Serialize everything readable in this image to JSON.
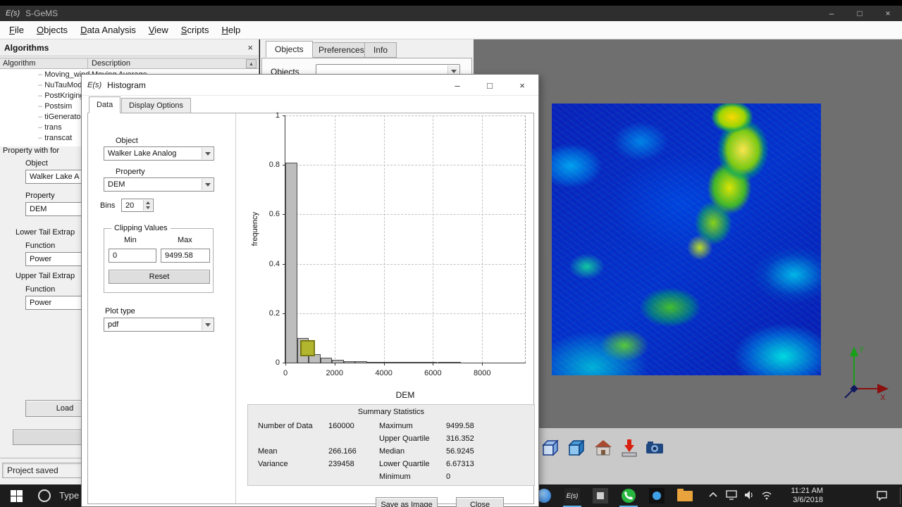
{
  "titlebar": {
    "logo": "E(s)",
    "title": "S-GeMS"
  },
  "icons": {
    "minimize": "–",
    "maximize": "□",
    "close": "×",
    "panel_close": "×",
    "scroll_up": "▴"
  },
  "menubar": {
    "items": [
      "File",
      "Objects",
      "Data Analysis",
      "View",
      "Scripts",
      "Help"
    ]
  },
  "algorithms": {
    "title": "Algorithms",
    "col1": "Algorithm",
    "col2": "Description",
    "rows": [
      {
        "name": "Moving_wind",
        "desc": "Moving Average"
      },
      {
        "name": "NuTauModel",
        "desc": ""
      },
      {
        "name": "PostKriging",
        "desc": ""
      },
      {
        "name": "Postsim",
        "desc": ""
      },
      {
        "name": "tiGenerator",
        "desc": ""
      },
      {
        "name": "trans",
        "desc": ""
      },
      {
        "name": "transcat",
        "desc": ""
      }
    ]
  },
  "params": {
    "header": "Property with for",
    "object_label": "Object",
    "object_value": "Walker Lake A",
    "property_label": "Property",
    "property_value": "DEM",
    "lower_group": "Lower Tail Extrap",
    "function_label": "Function",
    "lower_function": "Power",
    "upper_group": "Upper Tail Extrap",
    "upper_function": "Power",
    "load": "Load"
  },
  "statusbar": {
    "text": "Project saved"
  },
  "side_tabs": {
    "tabs": [
      "Objects",
      "Preferences",
      "Info"
    ],
    "objects_label": "Objects"
  },
  "dialog": {
    "logo": "E(s)",
    "title": "Histogram",
    "tabs": [
      "Data",
      "Display Options"
    ],
    "object_label": "Object",
    "object_value": "Walker Lake Analog",
    "property_label": "Property",
    "property_value": "DEM",
    "bins_label": "Bins",
    "bins_value": "20",
    "clipping_title": "Clipping Values",
    "min_label": "Min",
    "max_label": "Max",
    "min_value": "0",
    "max_value": "9499.58",
    "reset": "Reset",
    "plot_type_label": "Plot type",
    "plot_type_value": "pdf",
    "stats_title": "Summary Statistics",
    "stats_rows": [
      [
        "Number of Data",
        "160000",
        "Maximum",
        "9499.58"
      ],
      [
        "",
        "",
        "Upper Quartile",
        "316.352"
      ],
      [
        "Mean",
        "266.166",
        "Median",
        "56.9245"
      ],
      [
        "Variance",
        "239458",
        "Lower Quartile",
        "6.67313"
      ],
      [
        "",
        "",
        "Minimum",
        "0"
      ]
    ],
    "save_button": "Save as Image",
    "close_button": "Close"
  },
  "chart_data": {
    "type": "bar",
    "xlabel": "DEM",
    "ylabel": "frequency",
    "xlim": [
      0,
      9770
    ],
    "ylim": [
      0,
      1
    ],
    "x_ticks": [
      0,
      2000,
      4000,
      6000,
      8000
    ],
    "y_ticks": [
      0,
      0.2,
      0.4,
      0.6,
      0.8,
      1
    ],
    "bins": 20,
    "bin_start": 0,
    "bin_width": 474.98,
    "values": [
      0.81,
      0.1,
      0.033,
      0.02,
      0.012,
      0.007,
      0.0045,
      0.0028,
      0.0018,
      0.0012,
      0.0008,
      0.0005,
      0.0003,
      0.0002,
      0.0001,
      0,
      0,
      0,
      0,
      0
    ],
    "grid": true,
    "legend": "none",
    "bar_color": "#bdbdbd",
    "bar_border": "#4a4a4a",
    "marker": {
      "x": 915,
      "y": 0.057,
      "w": 21,
      "h": 23,
      "color": "#b2b52e",
      "border": "#7a7a14"
    }
  },
  "viewport": {
    "axis_x_label": "X",
    "axis_y_label": "Y"
  },
  "taskbar": {
    "search_text": "Type",
    "time": "11:21 AM",
    "date": "3/6/2018"
  }
}
